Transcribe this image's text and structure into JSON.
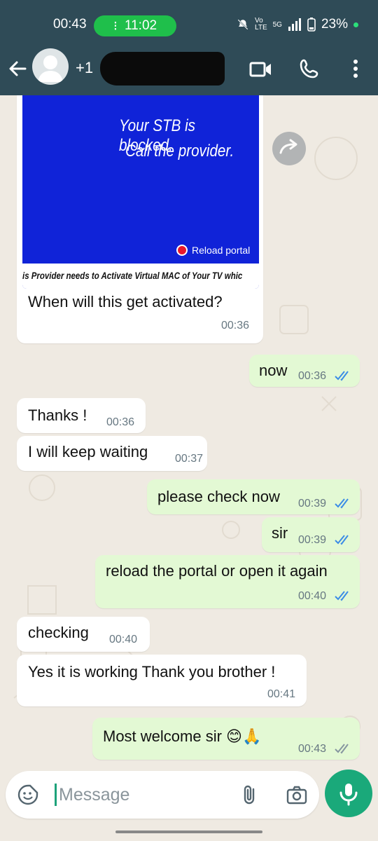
{
  "status_bar": {
    "time": "00:43",
    "call_timer": "11:02",
    "network": "5G",
    "battery": "23%"
  },
  "header": {
    "contact_prefix": "+1",
    "icons": [
      "back-arrow-icon",
      "avatar",
      "video-call-icon",
      "phone-icon",
      "more-icon"
    ]
  },
  "media_message": {
    "image_text_line1": "Your STB is blocked.",
    "image_text_line2": "Call the provider.",
    "image_button": "Reload portal",
    "image_caption": "is Provider needs to Activate Virtual MAC of Your TV whic",
    "text": "When will this get activated?",
    "time": "00:36"
  },
  "messages": [
    {
      "dir": "out",
      "text": "now",
      "time": "00:36",
      "status": "read"
    },
    {
      "dir": "in",
      "text": "Thanks !",
      "time": "00:36"
    },
    {
      "dir": "in",
      "text": "I will keep waiting",
      "time": "00:37"
    },
    {
      "dir": "out",
      "text": "please check now",
      "time": "00:39",
      "status": "read"
    },
    {
      "dir": "out",
      "text": "sir",
      "time": "00:39",
      "status": "read"
    },
    {
      "dir": "out",
      "text": "reload the portal or open it again",
      "time": "00:40",
      "status": "read"
    },
    {
      "dir": "in",
      "text": "checking",
      "time": "00:40"
    },
    {
      "dir": "in",
      "text": "Yes it is working Thank you brother !",
      "time": "00:41"
    },
    {
      "dir": "out",
      "text": "Most welcome sir 😊🙏",
      "time": "00:43",
      "status": "delivered"
    }
  ],
  "input": {
    "placeholder": "Message"
  },
  "colors": {
    "header_bg": "#2f4b57",
    "outgoing_bubble": "#e3f9d4",
    "incoming_bubble": "#ffffff",
    "chat_bg": "#efeae2",
    "read_tick": "#3b8ce6",
    "accent_green": "#1aa97a",
    "call_pill": "#1fbf4b"
  }
}
